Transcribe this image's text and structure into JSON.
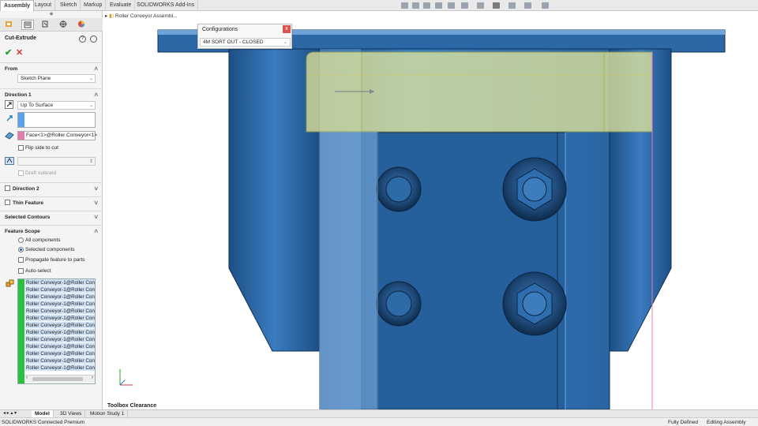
{
  "ribbon": {
    "tabs": [
      "Assembly",
      "Layout",
      "Sketch",
      "Markup",
      "Evaluate",
      "SOLIDWORKS Add-Ins"
    ]
  },
  "breadcrumb": "Roller Conveyor Assembl...",
  "feature": {
    "title": "Cut-Extrude",
    "help_label": "?",
    "ok_symbol": "✔",
    "cancel_symbol": "✕",
    "from": {
      "label": "From",
      "value": "Sketch Plane"
    },
    "direction1": {
      "label": "Direction 1",
      "end_condition": "Up To Surface",
      "face_reference": "Face<1>@Roller Conveyor<1>",
      "flip_label": "Flip side to cut",
      "draft_label": "Draft outward"
    },
    "direction2_label": "Direction 2",
    "thin_feature_label": "Thin Feature",
    "selected_contours_label": "Selected Contours",
    "feature_scope": {
      "label": "Feature Scope",
      "options": [
        "All components",
        "Selected components"
      ],
      "selected": "Selected components",
      "propagate_label": "Propagate feature to parts",
      "autoselect_label": "Auto-select",
      "components": [
        "Roller Conveyor-1@Roller Con",
        "Roller Conveyor-1@Roller Con",
        "Roller Conveyor-1@Roller Con",
        "Roller Conveyor-1@Roller Con",
        "Roller Conveyor-1@Roller Con",
        "Roller Conveyor-1@Roller Con",
        "Roller Conveyor-1@Roller Con",
        "Roller Conveyor-1@Roller Con",
        "Roller Conveyor-1@Roller Con",
        "Roller Conveyor-1@Roller Con",
        "Roller Conveyor-1@Roller Con",
        "Roller Conveyor-1@Roller Con",
        "Roller Conveyor-1@Roller Con"
      ]
    }
  },
  "configurations": {
    "title": "Configurations",
    "close": "x",
    "selected": "4M SORT OUT - CLOSED"
  },
  "viewport_label": "Toolbox Clearance",
  "bottom_tabs": [
    "Model",
    "3D Views",
    "Motion Study 1"
  ],
  "status": {
    "product": "SOLIDWORKS Connected Premium",
    "definition": "Fully Defined",
    "mode": "Editing Assembly"
  },
  "colors": {
    "model_blue": "#2f6fad",
    "cut_preview_yellow": "#e6e89a",
    "selection_green": "#27c13d",
    "selection_pink": "#e87ab0"
  }
}
